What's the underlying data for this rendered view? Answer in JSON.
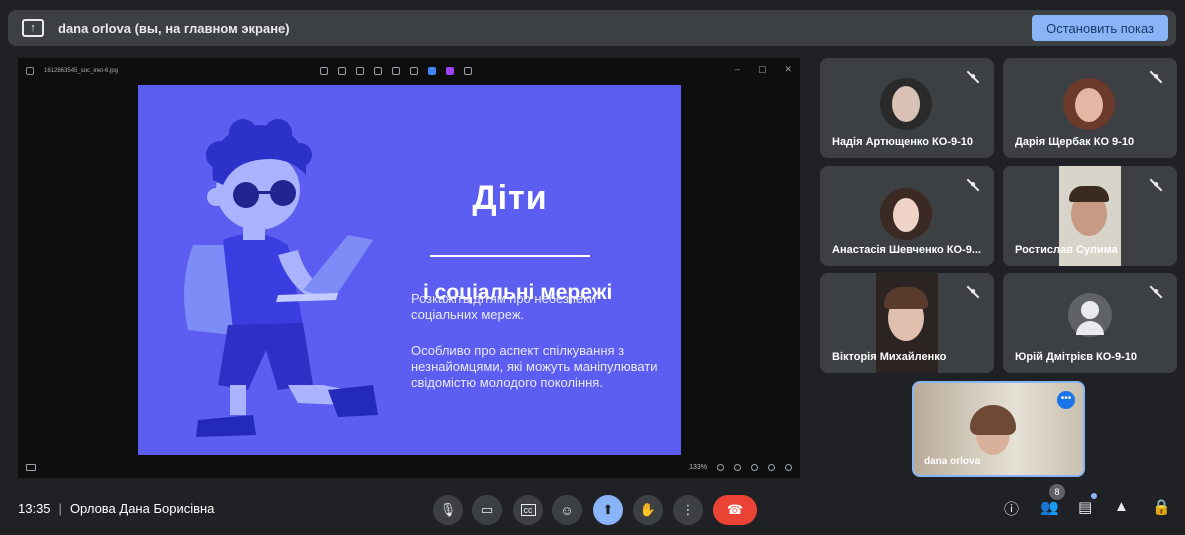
{
  "present_bar": {
    "title": "dana orlova (вы, на главном экране)",
    "stop_label": "Остановить показ"
  },
  "viewer": {
    "file_name": "1612863545_soc_inet-6.jpg",
    "zoom": "133%",
    "window_controls": [
      "–",
      "▢",
      "✕"
    ]
  },
  "slide": {
    "title_line1": "Діти",
    "title_line2": "і соціальні мережі",
    "paragraph1": "Розкажіть дітям про небезпеки соціальних мереж.",
    "paragraph2": "Особливо про аспект спілкування з незнайомцями, які можуть маніпулювати свідомістю молодого покоління."
  },
  "participants": [
    {
      "name": "Надія Артющенко КО-9-10",
      "muted": true
    },
    {
      "name": "Дарія Щербак КО 9-10",
      "muted": true
    },
    {
      "name": "Анастасія Шевченко КО-9...",
      "muted": true
    },
    {
      "name": "Ростислав Сулима",
      "muted": true
    },
    {
      "name": "Вікторія Михайленко",
      "muted": true
    },
    {
      "name": "Юрій Дмітрієв КО-9-10",
      "muted": true
    }
  ],
  "self_tile": {
    "name": "dana orlova",
    "more": "•••"
  },
  "bottom_bar": {
    "time": "13:35",
    "separator": "|",
    "meeting_name": "Орлова Дана Борисівна",
    "participants_count": "8"
  },
  "colors": {
    "background": "#202124",
    "tile": "#3c4043",
    "accent": "#8ab4f8",
    "end_call": "#ea4335",
    "slide": "#5b5ef0"
  },
  "icons": {
    "mic": "mic-icon",
    "camera": "camera-icon",
    "captions": "captions-icon",
    "emoji": "emoji-icon",
    "present": "present-icon",
    "hand": "hand-icon",
    "more": "more-icon",
    "end_call": "end-call-icon",
    "info": "info-icon",
    "people": "people-icon",
    "chat": "chat-icon",
    "activities": "activities-icon",
    "host_controls": "host-controls-icon"
  }
}
